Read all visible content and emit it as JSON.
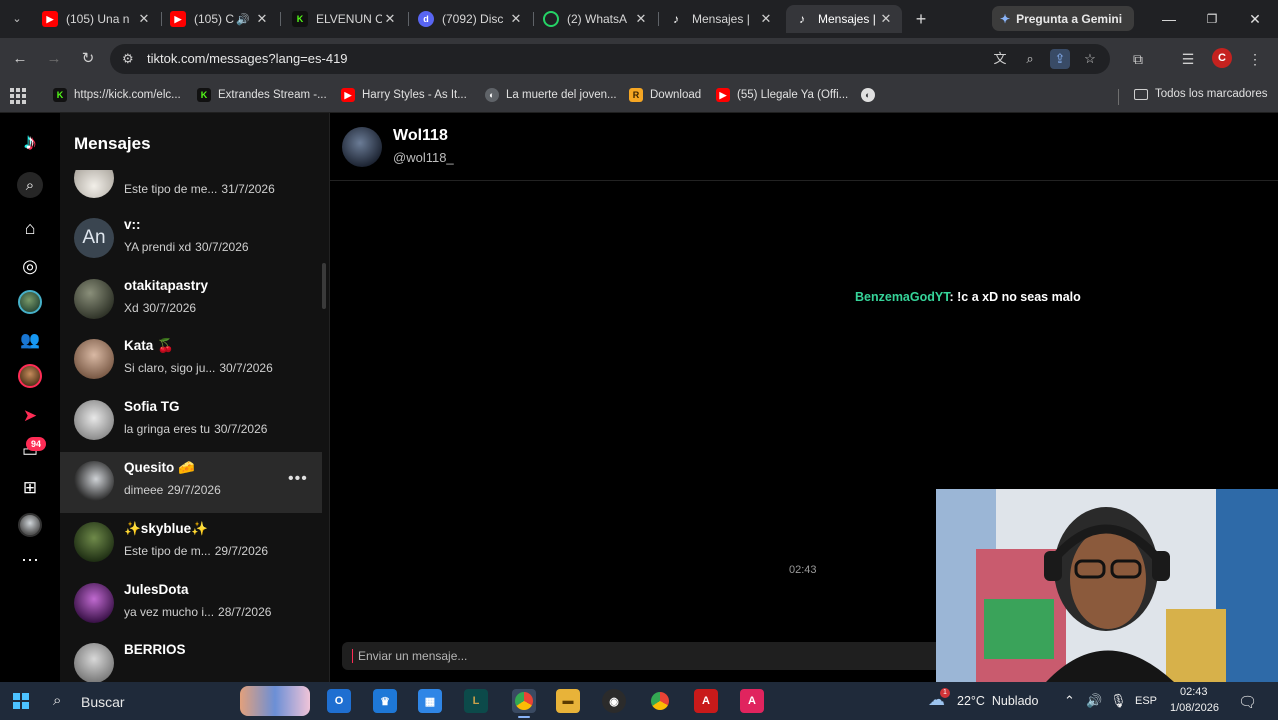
{
  "browser": {
    "tabs": [
      {
        "title": "(105) Una n",
        "icon": "youtube-icon",
        "audio": false,
        "active": false
      },
      {
        "title": "(105) C",
        "icon": "youtube-icon",
        "audio": true,
        "active": false
      },
      {
        "title": "ELVENUN C",
        "icon": "kick-icon",
        "audio": false,
        "active": false
      },
      {
        "title": "(7092) Disc",
        "icon": "discord-icon",
        "audio": false,
        "active": false
      },
      {
        "title": "(2) WhatsA",
        "icon": "whatsapp-icon",
        "audio": false,
        "active": false
      },
      {
        "title": "Mensajes |",
        "icon": "tiktok-icon",
        "audio": false,
        "active": false
      },
      {
        "title": "Mensajes |",
        "icon": "tiktok-icon",
        "audio": false,
        "active": true
      }
    ],
    "gemini_label": "Pregunta a Gemini",
    "url": "tiktok.com/messages?lang=es-419",
    "profile_initial": "C",
    "bookmarks": [
      {
        "label": "https://kick.com/elc...",
        "icon": "kick-icon"
      },
      {
        "label": "Extrandes Stream -...",
        "icon": "kick-icon"
      },
      {
        "label": "Harry Styles - As It...",
        "icon": "youtube-icon"
      },
      {
        "label": "La muerte del joven...",
        "icon": "globe-icon"
      },
      {
        "label": "Download",
        "icon": "download-site-icon"
      },
      {
        "label": "(55) Llegale Ya (Offi...",
        "icon": "youtube-icon"
      },
      {
        "label": "",
        "icon": "globe-icon"
      }
    ],
    "all_bookmarks_label": "Todos los marcadores"
  },
  "tiktok": {
    "rail_badge": "94",
    "conversations_title": "Mensajes",
    "conversations": [
      {
        "name": "",
        "preview": "Este tipo de me...",
        "date": "31/7/2026",
        "avatar": "photo"
      },
      {
        "name": "v::",
        "preview": "YA prendi xd",
        "date": "30/7/2026",
        "avatar_text": "An"
      },
      {
        "name": "otakitapastry",
        "preview": "Xd",
        "date": "30/7/2026",
        "avatar": "photo"
      },
      {
        "name": "Kata 🍒",
        "preview": "Si claro, sigo ju...",
        "date": "30/7/2026",
        "avatar": "photo"
      },
      {
        "name": "Sofia TG",
        "preview": "la gringa eres tu",
        "date": "30/7/2026",
        "avatar": "photo"
      },
      {
        "name": "Quesito 🧀",
        "preview": "dimeee",
        "date": "29/7/2026",
        "avatar": "photo",
        "hovered": true
      },
      {
        "name": "✨skyblue✨",
        "preview": "Este tipo de m...",
        "date": "29/7/2026",
        "avatar": "photo"
      },
      {
        "name": "JulesDota",
        "preview": "ya vez mucho i...",
        "date": "28/7/2026",
        "avatar": "photo"
      },
      {
        "name": "BERRIOS",
        "preview": "",
        "date": "",
        "avatar": "photo"
      }
    ],
    "chat": {
      "name": "Wol118",
      "handle": "@wol118_",
      "overlay_user": "BenzemaGodYT",
      "overlay_text": ": !c a xD no seas malo",
      "time": "02:43",
      "composer_placeholder": "Enviar un mensaje..."
    },
    "accent": "#fe2c55"
  },
  "taskbar": {
    "search_label": "Buscar",
    "weather": "22°C  Nublado",
    "weather_badge": "1",
    "language": "ESP",
    "time": "02:43",
    "date": "1/08/2026"
  }
}
